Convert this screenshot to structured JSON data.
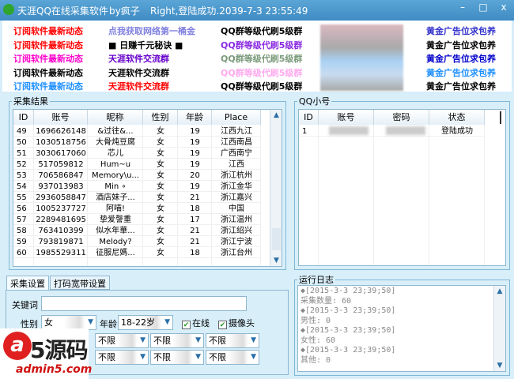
{
  "title": {
    "app": "天涯QQ在线采集软件",
    "author": "by疯子",
    "status": "Right,登陆成功.2039-7-3 23:55:49",
    "min": "–",
    "max": "□",
    "close": "x"
  },
  "links": [
    {
      "text": "订阅软件最新动态",
      "color": "#ff0000",
      "col": 0,
      "row": 0
    },
    {
      "text": "点我获取网络第一桶金",
      "color": "#8080e0",
      "col": 1,
      "row": 0
    },
    {
      "text": "QQ群等级代刷5级群",
      "color": "#000000",
      "col": 2,
      "row": 0
    },
    {
      "text": "黄金广告位求包养",
      "color": "#3333cc",
      "col": 4,
      "row": 0
    },
    {
      "text": "订阅软件最新动态",
      "color": "#ff0000",
      "col": 0,
      "row": 1
    },
    {
      "text": "■ 日赚千元秘诀 ■",
      "color": "#000000",
      "col": 1,
      "row": 1
    },
    {
      "text": "QQ群等级代刷5级群",
      "color": "#8a2be2",
      "col": 2,
      "row": 1
    },
    {
      "text": "黄金广告位求包养",
      "color": "#000000",
      "col": 4,
      "row": 1
    },
    {
      "text": "订阅软件最新动态",
      "color": "#ff00cc",
      "col": 0,
      "row": 2
    },
    {
      "text": "天涯软件交流群",
      "color": "#6600cc",
      "col": 1,
      "row": 2
    },
    {
      "text": "QQ群等级代刷5级群",
      "color": "#7a9a7a",
      "col": 2,
      "row": 2
    },
    {
      "text": "黄金广告位求包养",
      "color": "#0000cc",
      "col": 4,
      "row": 2
    },
    {
      "text": "订阅软件最新动态",
      "color": "#000000",
      "col": 0,
      "row": 3
    },
    {
      "text": "天涯软件交流群",
      "color": "#000000",
      "col": 1,
      "row": 3
    },
    {
      "text": "QQ群等级代刷5级群",
      "color": "#ffaaee",
      "col": 2,
      "row": 3
    },
    {
      "text": "黄金广告位求包养",
      "color": "#1e90ff",
      "col": 4,
      "row": 3
    },
    {
      "text": "订阅软件最新动态",
      "color": "#1e90ff",
      "col": 0,
      "row": 4
    },
    {
      "text": "天涯软件交流群",
      "color": "#ff0000",
      "col": 1,
      "row": 4
    },
    {
      "text": "QQ群等级代刷5级群",
      "color": "#000000",
      "col": 2,
      "row": 4
    },
    {
      "text": "黄金广告位求包养",
      "color": "#000000",
      "col": 4,
      "row": 4
    }
  ],
  "results": {
    "legend": "采集结果",
    "headers": [
      "ID",
      "账号",
      "昵称",
      "性别",
      "年龄",
      "Place"
    ],
    "rows": [
      [
        "49",
        "1696626148",
        "&过往&...",
        "女",
        "19",
        "江西九江"
      ],
      [
        "50",
        "1030518756",
        "大骨炖豆腐",
        "女",
        "19",
        "江西南昌"
      ],
      [
        "51",
        "3030617060",
        "芯儿",
        "女",
        "19",
        "广西南宁"
      ],
      [
        "52",
        "517059812",
        "Hum~u",
        "女",
        "19",
        "江西"
      ],
      [
        "53",
        "706586847",
        "Memory\\u...",
        "女",
        "20",
        "浙江杭州"
      ],
      [
        "54",
        "937013983",
        "Min ∘",
        "女",
        "19",
        "浙江金华"
      ],
      [
        "55",
        "2936058847",
        "酒店妹子...",
        "女",
        "21",
        "浙江嘉兴"
      ],
      [
        "56",
        "1005237727",
        "阿喵!",
        "女",
        "18",
        "中国"
      ],
      [
        "57",
        "2289481695",
        "挚爱謦重",
        "女",
        "17",
        "浙江温州"
      ],
      [
        "58",
        "763410399",
        "似水年華...",
        "女",
        "21",
        "浙江绍兴"
      ],
      [
        "59",
        "793819871",
        "Melody?",
        "女",
        "21",
        "浙江宁波"
      ],
      [
        "60",
        "1985529311",
        "征服尼媽...",
        "女",
        "18",
        "浙江台州"
      ]
    ]
  },
  "qq": {
    "legend": "QQ小号",
    "headers": [
      "ID",
      "账号",
      "密码",
      "状态"
    ],
    "rows": [
      [
        "1",
        "",
        "",
        "登陆成功"
      ]
    ]
  },
  "tabs": [
    "采集设置",
    "打码宽带设置"
  ],
  "settings": {
    "keyword_label": "关键词",
    "keyword_value": "",
    "gender_label": "性别",
    "gender_value": "女",
    "age_label": "年龄",
    "age_value": "18-22岁",
    "online_label": "在线",
    "camera_label": "摄像头",
    "row3": [
      "不限",
      "不限",
      "不限"
    ],
    "row4": [
      "不限",
      "不限",
      "不限"
    ]
  },
  "log": {
    "legend": "运行日志",
    "lines": [
      "◆[2015-3-3 23;39;50]",
      "采集数量: 60",
      "◆[2015-3-3 23;39;50]",
      "男性: 0",
      "◆[2015-3-3 23;39;50]",
      "女性: 60",
      "◆[2015-3-3 23;39;50]",
      "其他: 0"
    ]
  },
  "watermark": {
    "logo": "a5源码",
    "url": "admin5.com"
  }
}
